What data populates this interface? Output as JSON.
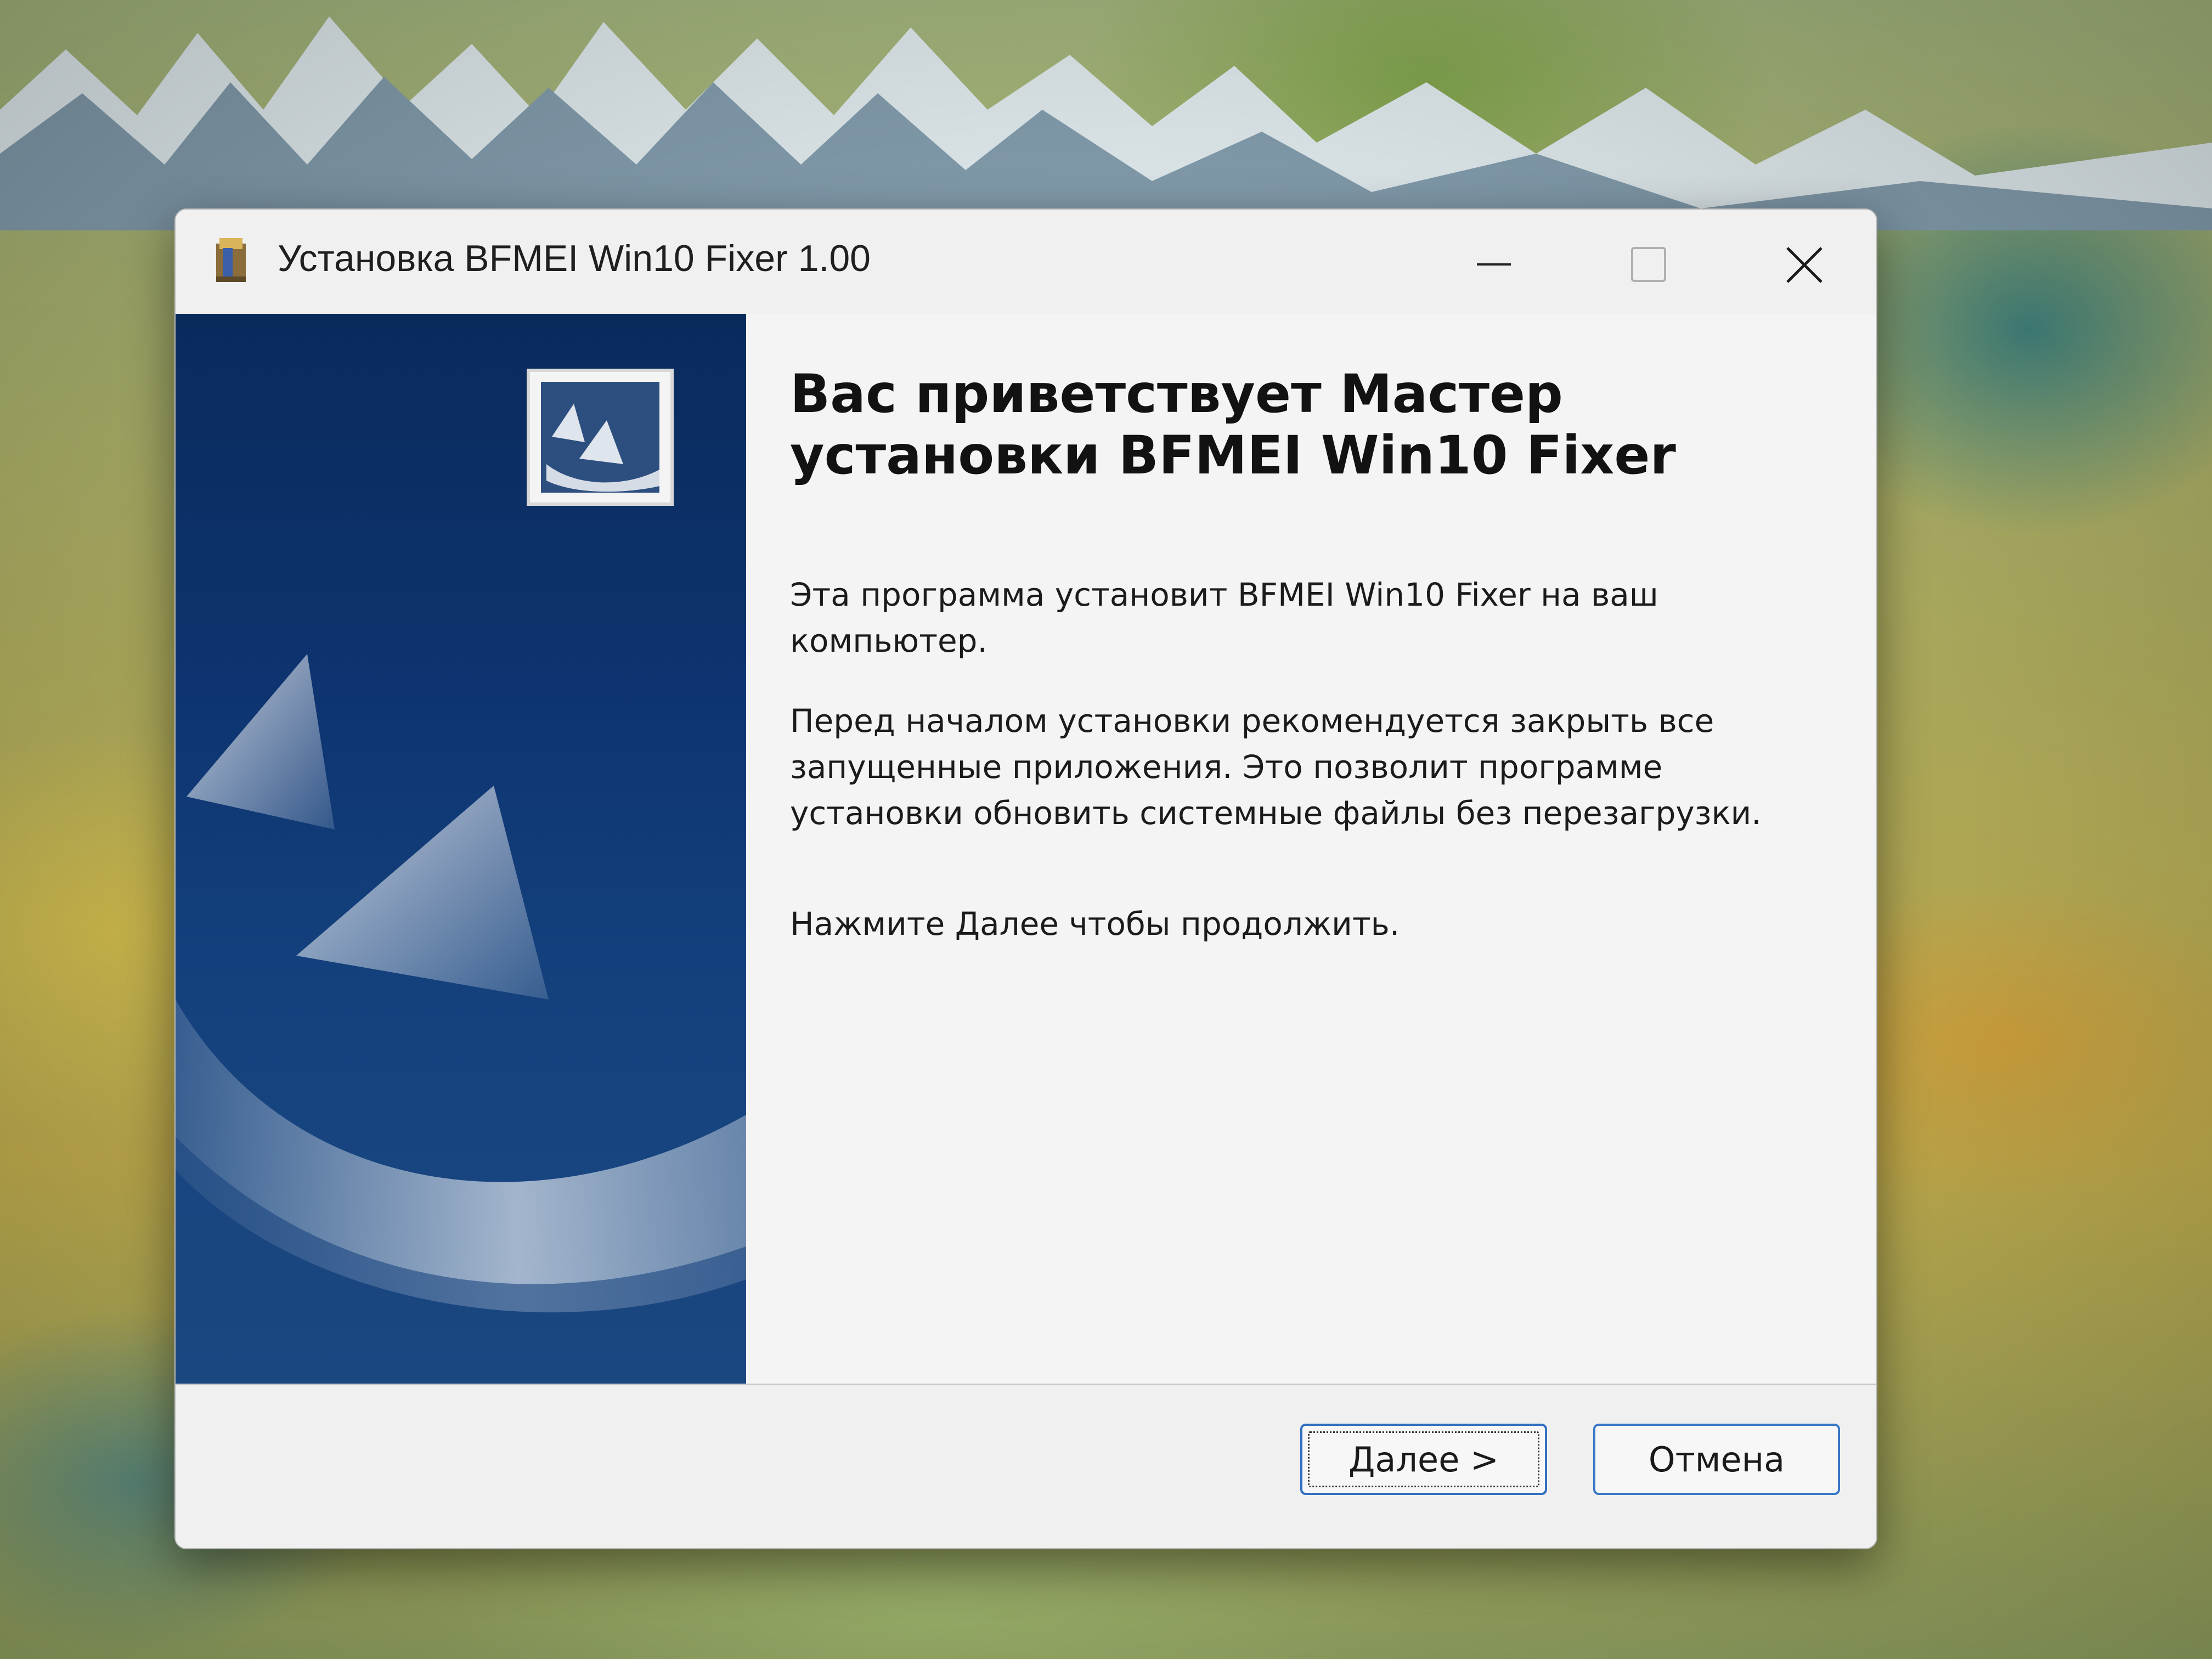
{
  "window": {
    "title": "Установка BFMEI Win10 Fixer 1.00"
  },
  "welcome": {
    "heading": "Вас приветствует Мастер установки BFMEI Win10 Fixer",
    "paragraph_1": "Эта программа установит BFMEI Win10 Fixer на ваш компьютер.",
    "paragraph_2": "Перед началом установки рекомендуется закрыть все запущенные приложения. Это позволит программе установки обновить системные файлы без перезагрузки.",
    "paragraph_3": "Нажмите Далее чтобы продолжить."
  },
  "buttons": {
    "next_label": "Далее >",
    "cancel_label": "Отмена"
  },
  "icons": {
    "app": "installer-package-icon",
    "minimize": "minimize-icon",
    "maximize": "maximize-icon",
    "close": "close-icon",
    "wizard_logo": "wizard-logo-icon"
  },
  "colors": {
    "accent": "#2f6fc0",
    "side_panel": "#0d3470"
  }
}
